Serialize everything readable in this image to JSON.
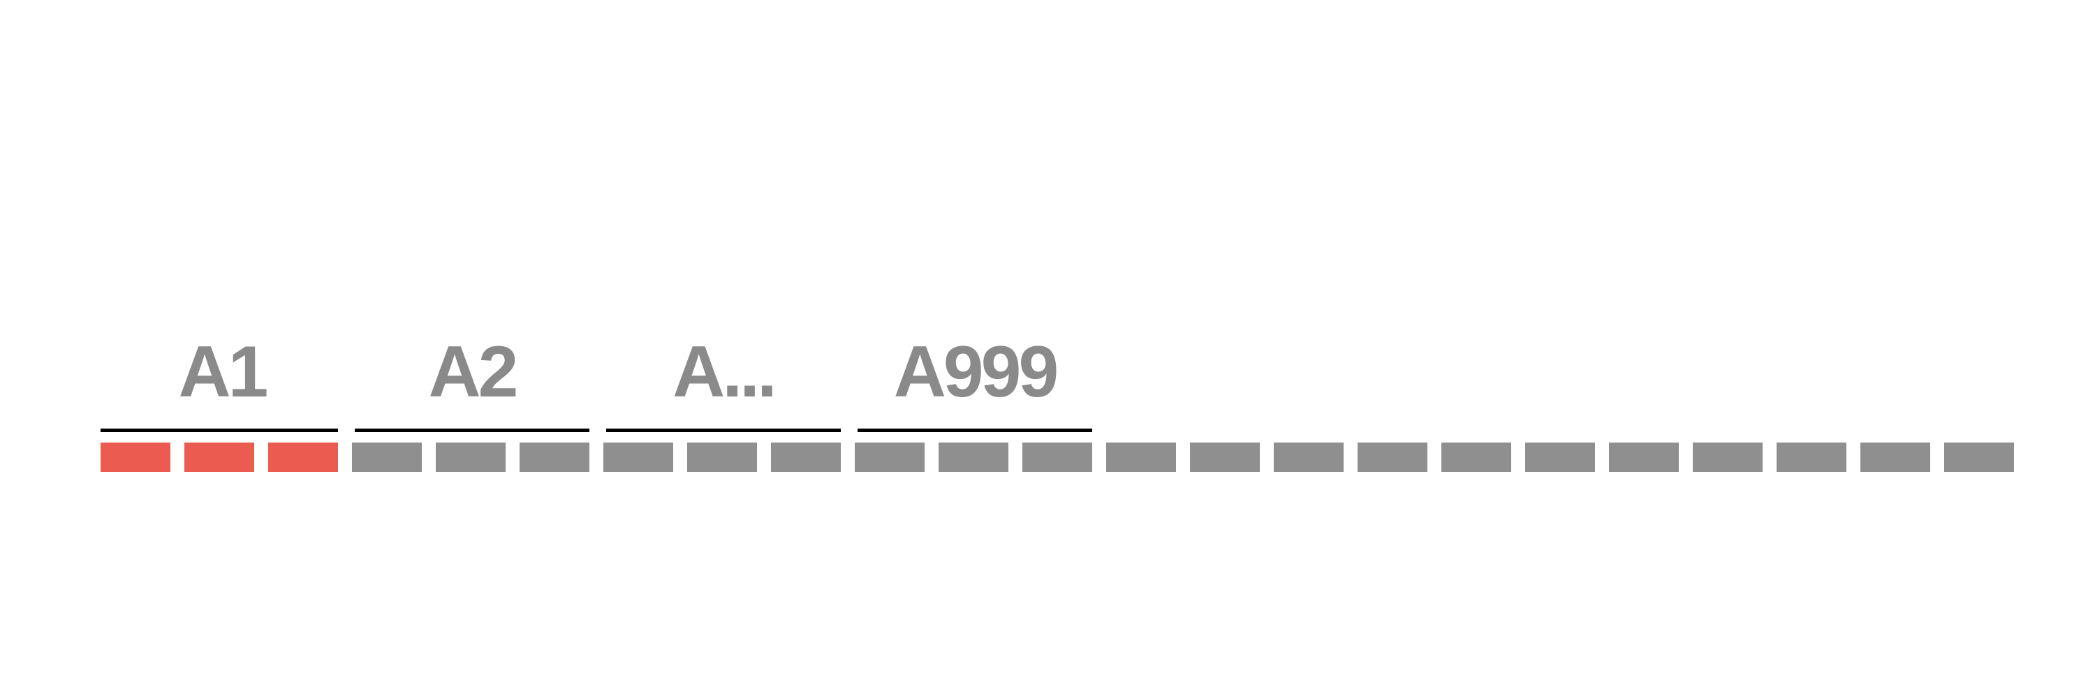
{
  "colors": {
    "highlight": "#ec5b4f",
    "block": "#8f8f8f",
    "label": "#8a8a8a",
    "bracket": "#000000",
    "background": "#ffffff"
  },
  "diagram": {
    "total_blocks": 23,
    "highlighted_blocks": 3,
    "groups": [
      {
        "label": "A1",
        "first_block": 0,
        "block_count": 3
      },
      {
        "label": "A2",
        "first_block": 3,
        "block_count": 3
      },
      {
        "label": "A...",
        "first_block": 6,
        "block_count": 3
      },
      {
        "label": "A999",
        "first_block": 9,
        "block_count": 3
      }
    ]
  }
}
